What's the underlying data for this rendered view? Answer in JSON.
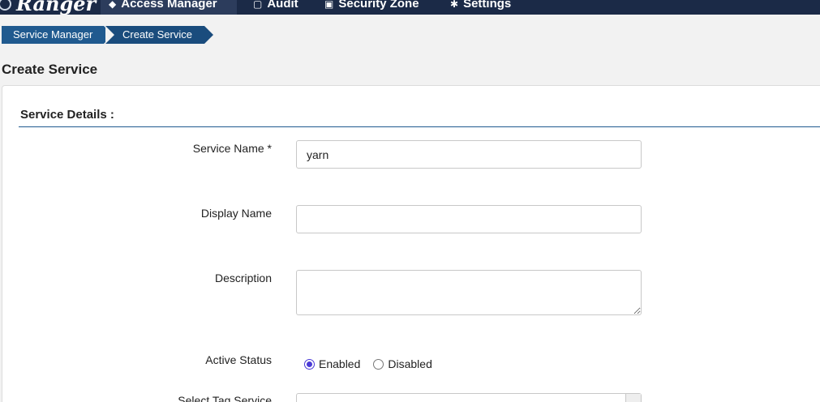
{
  "app": {
    "logo_text": "Ranger"
  },
  "nav": {
    "items": [
      {
        "label": "Access Manager",
        "icon": "shield-icon"
      },
      {
        "label": "Audit",
        "icon": "file-icon"
      },
      {
        "label": "Security Zone",
        "icon": "zone-icon"
      },
      {
        "label": "Settings",
        "icon": "gear-icon"
      }
    ]
  },
  "breadcrumb": {
    "items": [
      "Service Manager",
      "Create Service"
    ]
  },
  "page": {
    "title": "Create Service"
  },
  "form": {
    "section_title": "Service Details :",
    "service_name": {
      "label": "Service Name *",
      "value": "yarn"
    },
    "display_name": {
      "label": "Display Name",
      "value": ""
    },
    "description": {
      "label": "Description",
      "value": ""
    },
    "active_status": {
      "label": "Active Status",
      "options": [
        "Enabled",
        "Disabled"
      ],
      "selected": "Enabled"
    },
    "tag_service": {
      "label": "Select Tag Service"
    }
  },
  "colors": {
    "navbar": "#1b2a47",
    "breadcrumb": "#205a8f",
    "radio_accent": "#4a3ad6"
  }
}
